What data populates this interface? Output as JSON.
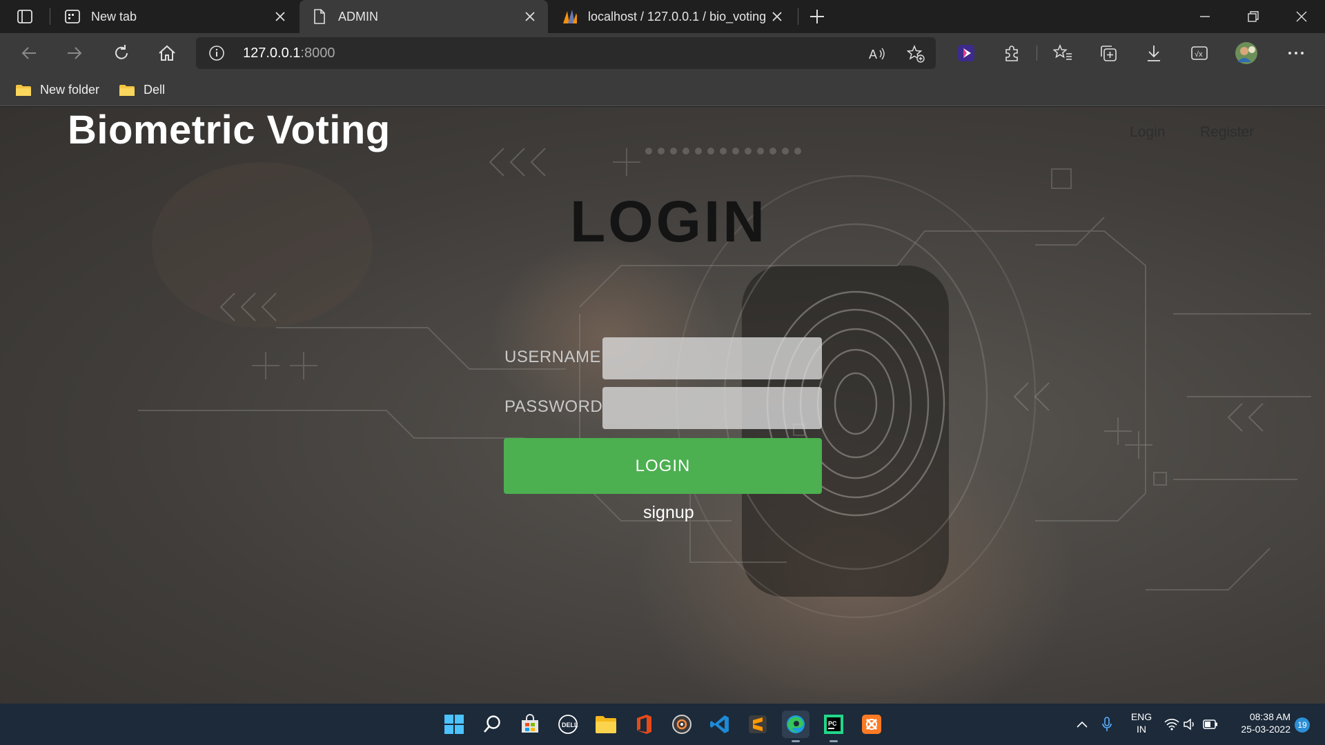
{
  "browser": {
    "tabs": [
      {
        "title": "New tab",
        "icon": "newtab-icon",
        "active": false
      },
      {
        "title": "ADMIN",
        "icon": "page-icon",
        "active": true
      },
      {
        "title": "localhost / 127.0.0.1 / bio_voting",
        "icon": "phpmyadmin-icon",
        "active": false
      }
    ],
    "address": {
      "host": "127.0.0.1",
      "port": ":8000"
    },
    "bookmarks": [
      {
        "label": "New folder",
        "icon": "folder-icon"
      },
      {
        "label": "Dell",
        "icon": "folder-icon"
      }
    ]
  },
  "page": {
    "brand": "Biometric Voting",
    "nav": {
      "login": "Login",
      "register": "Register"
    },
    "title": "LOGIN",
    "form": {
      "username_label": "USERNAME",
      "password_label": "PASSWORD",
      "submit": "LOGIN",
      "signup": "signup"
    }
  },
  "taskbar": {
    "lang_line1": "ENG",
    "lang_line2": "IN",
    "time": "08:38 AM",
    "date": "25-03-2022",
    "notifications": "19"
  },
  "colors": {
    "accent_green": "#4caf50",
    "chrome_dark": "#1f1f1f",
    "chrome_mid": "#3b3b3b",
    "taskbar": "#1c2a3a"
  }
}
